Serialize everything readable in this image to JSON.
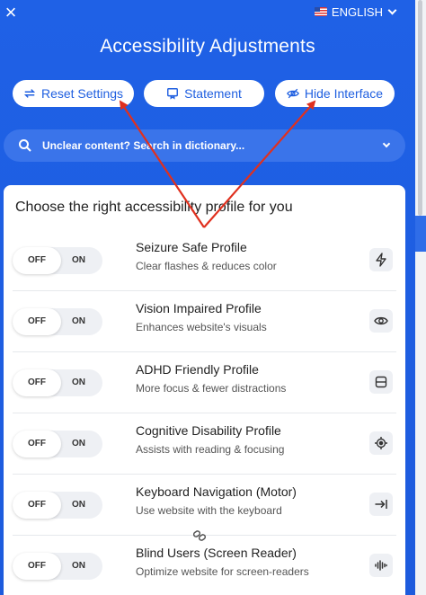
{
  "header": {
    "close_icon": "close-icon",
    "language": "ENGLISH",
    "title": "Accessibility Adjustments"
  },
  "actions": {
    "reset_label": "Reset Settings",
    "statement_label": "Statement",
    "hide_label": "Hide Interface"
  },
  "search": {
    "label": "Unclear content? Search in dictionary..."
  },
  "profiles": {
    "heading": "Choose the right accessibility profile for you",
    "off_label": "OFF",
    "on_label": "ON",
    "items": [
      {
        "name": "Seizure Safe Profile",
        "desc": "Clear flashes & reduces color",
        "icon": "lightning-icon"
      },
      {
        "name": "Vision Impaired Profile",
        "desc": "Enhances website's visuals",
        "icon": "eye-icon"
      },
      {
        "name": "ADHD Friendly Profile",
        "desc": "More focus & fewer distractions",
        "icon": "window-icon"
      },
      {
        "name": "Cognitive Disability Profile",
        "desc": "Assists with reading & focusing",
        "icon": "target-icon"
      },
      {
        "name": "Keyboard Navigation (Motor)",
        "desc": "Use website with the keyboard",
        "icon": "arrow-to-line-icon"
      },
      {
        "name": "Blind Users (Screen Reader)",
        "desc": "Optimize website for screen-readers",
        "icon": "audio-wave-icon"
      }
    ]
  },
  "colors": {
    "primary": "#1f5fe0",
    "annotation_arrow": "#e0301e"
  }
}
